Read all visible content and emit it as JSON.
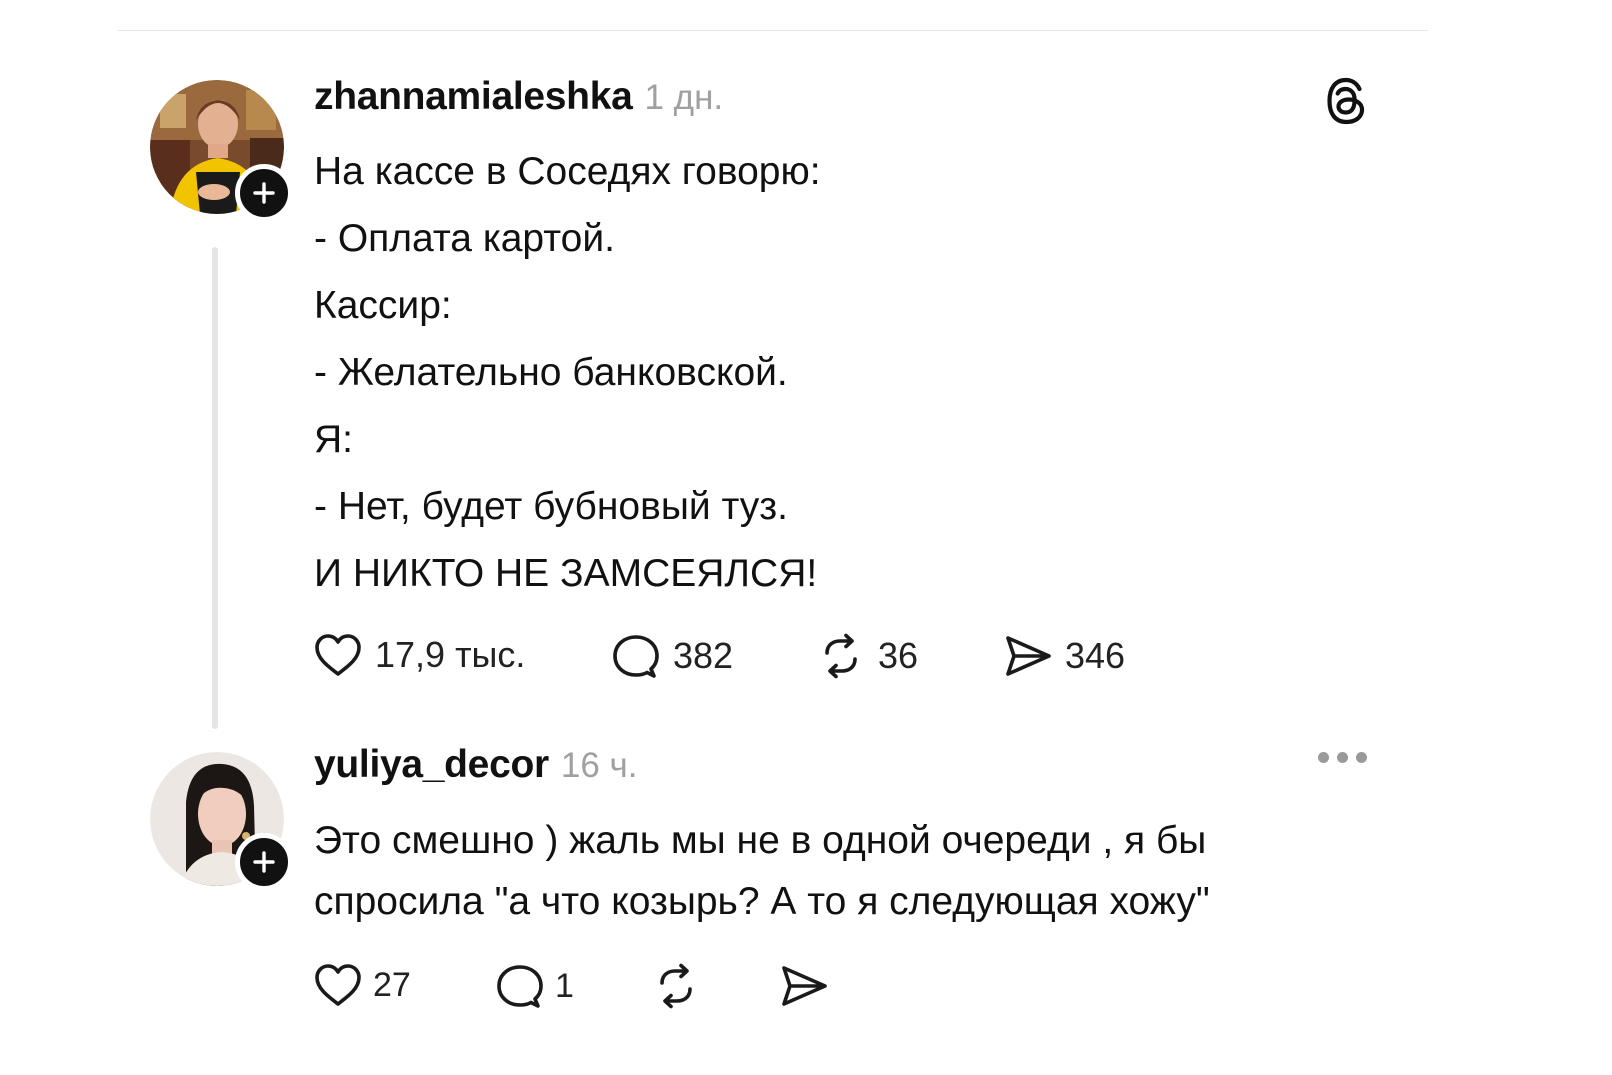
{
  "post": {
    "username": "zhannamialeshka",
    "time": "1 дн.",
    "avatar_icon": "profile-photo-woman-yellow-dress",
    "follow_icon": "plus-icon",
    "lines": [
      "На кассе в Соседях говорю:",
      "- Оплата картой.",
      "Кассир:",
      "- Желательно банковской.",
      "Я:",
      "- Нет, будет бубновый туз.",
      "И НИКТО НЕ ЗАМСЕЯЛСЯ!"
    ],
    "actions": {
      "likes": "17,9 тыс.",
      "comments": "382",
      "reposts": "36",
      "shares": "346"
    },
    "brand_icon": "threads-logo-icon"
  },
  "reply": {
    "username": "yuliya_decor",
    "time": "16 ч.",
    "avatar_icon": "profile-photo-woman-dark-hair",
    "follow_icon": "plus-icon",
    "lines": [
      "Это смешно ) жаль мы не в одной очереди , я бы",
      "спросила \"а что козырь? А то я следующая хожу\""
    ],
    "actions": {
      "likes": "27",
      "comments": "1"
    },
    "menu_icon": "more-options-icon"
  },
  "colors": {
    "text": "#111111",
    "muted": "#a0a0a0",
    "divider": "#e6e6e6",
    "thread_line": "#e5e5e5"
  }
}
